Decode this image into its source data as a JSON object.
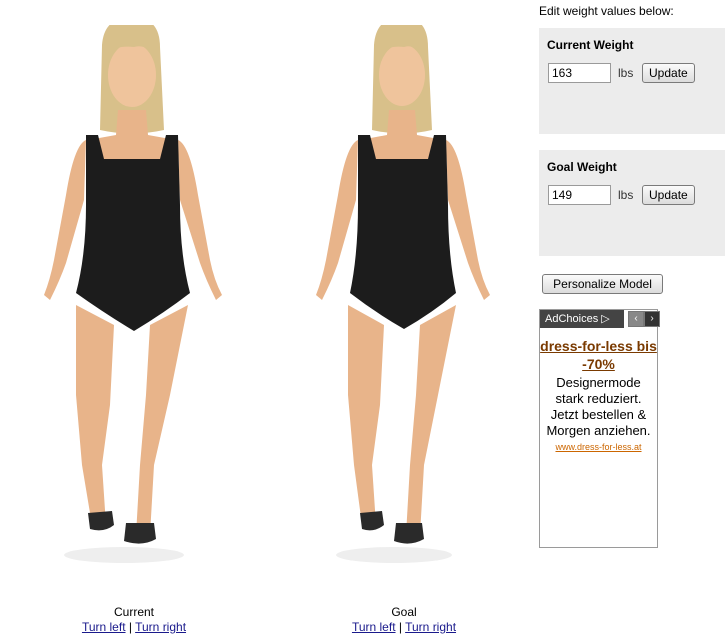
{
  "models": {
    "current": {
      "caption": "Current",
      "turn_left": "Turn left",
      "turn_right": "Turn right",
      "separator": "|"
    },
    "goal": {
      "caption": "Goal",
      "turn_left": "Turn left",
      "turn_right": "Turn right",
      "separator": "|"
    }
  },
  "sidebar": {
    "title": "Edit weight values below:",
    "current": {
      "label": "Current Weight",
      "value": "163",
      "unit": "lbs",
      "button": "Update"
    },
    "goal": {
      "label": "Goal Weight",
      "value": "149",
      "unit": "lbs",
      "button": "Update"
    },
    "personalize_button": "Personalize Model"
  },
  "ad": {
    "adchoices": "AdChoices",
    "headline": "dress-for-less bis -70%",
    "body": "Designermode stark reduziert. Jetzt bestellen & Morgen anziehen.",
    "url": "www.dress-for-less.at",
    "prev_icon": "chevron-left-icon",
    "next_icon": "chevron-right-icon"
  },
  "colors": {
    "panel_bg": "#ececec",
    "swimsuit": "#1c1c1c",
    "skin": "#e8b48a",
    "hair": "#d8c08a",
    "link": "#1a1a8c",
    "ad_headline": "#7a3a00",
    "ad_url": "#cc6600"
  }
}
